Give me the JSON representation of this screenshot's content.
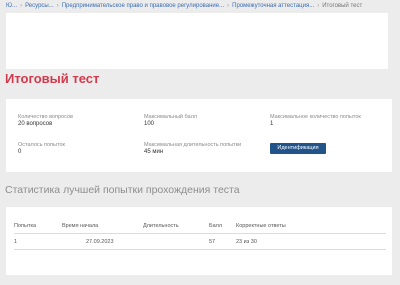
{
  "breadcrumb": {
    "items": [
      "Ю...",
      "Ресурсы...",
      "Предпринимательское право и правовое регулирование...",
      "Промежуточная аттестация...",
      "Итоговый тест"
    ]
  },
  "page_title": "Итоговый тест",
  "test_info": {
    "questions_label": "Количество вопросов",
    "questions_value": "20 вопросов",
    "max_score_label": "Максимальный балл",
    "max_score_value": "100",
    "attempts_label": "Максимальное количество попыток",
    "attempts_value": "1",
    "attempts_left_label": "Осталось попыток",
    "attempts_left_value": "0",
    "duration_label": "Максимальная длительность попытки",
    "duration_value": "45 мин",
    "identify_button": "Идентификация"
  },
  "stats_title": "Статистика лучшей попытки прохождения теста",
  "results_table": {
    "headers": [
      "Попытка",
      "Время начала",
      "Длительность",
      "Балл",
      "Корректные ответы"
    ],
    "rows": [
      [
        "1",
        "27.09.2023",
        "",
        "57",
        "23 из 30"
      ]
    ]
  },
  "colors": {
    "title_accent": "#d23a4d",
    "button": "#22548a",
    "link": "#3a6db5"
  }
}
